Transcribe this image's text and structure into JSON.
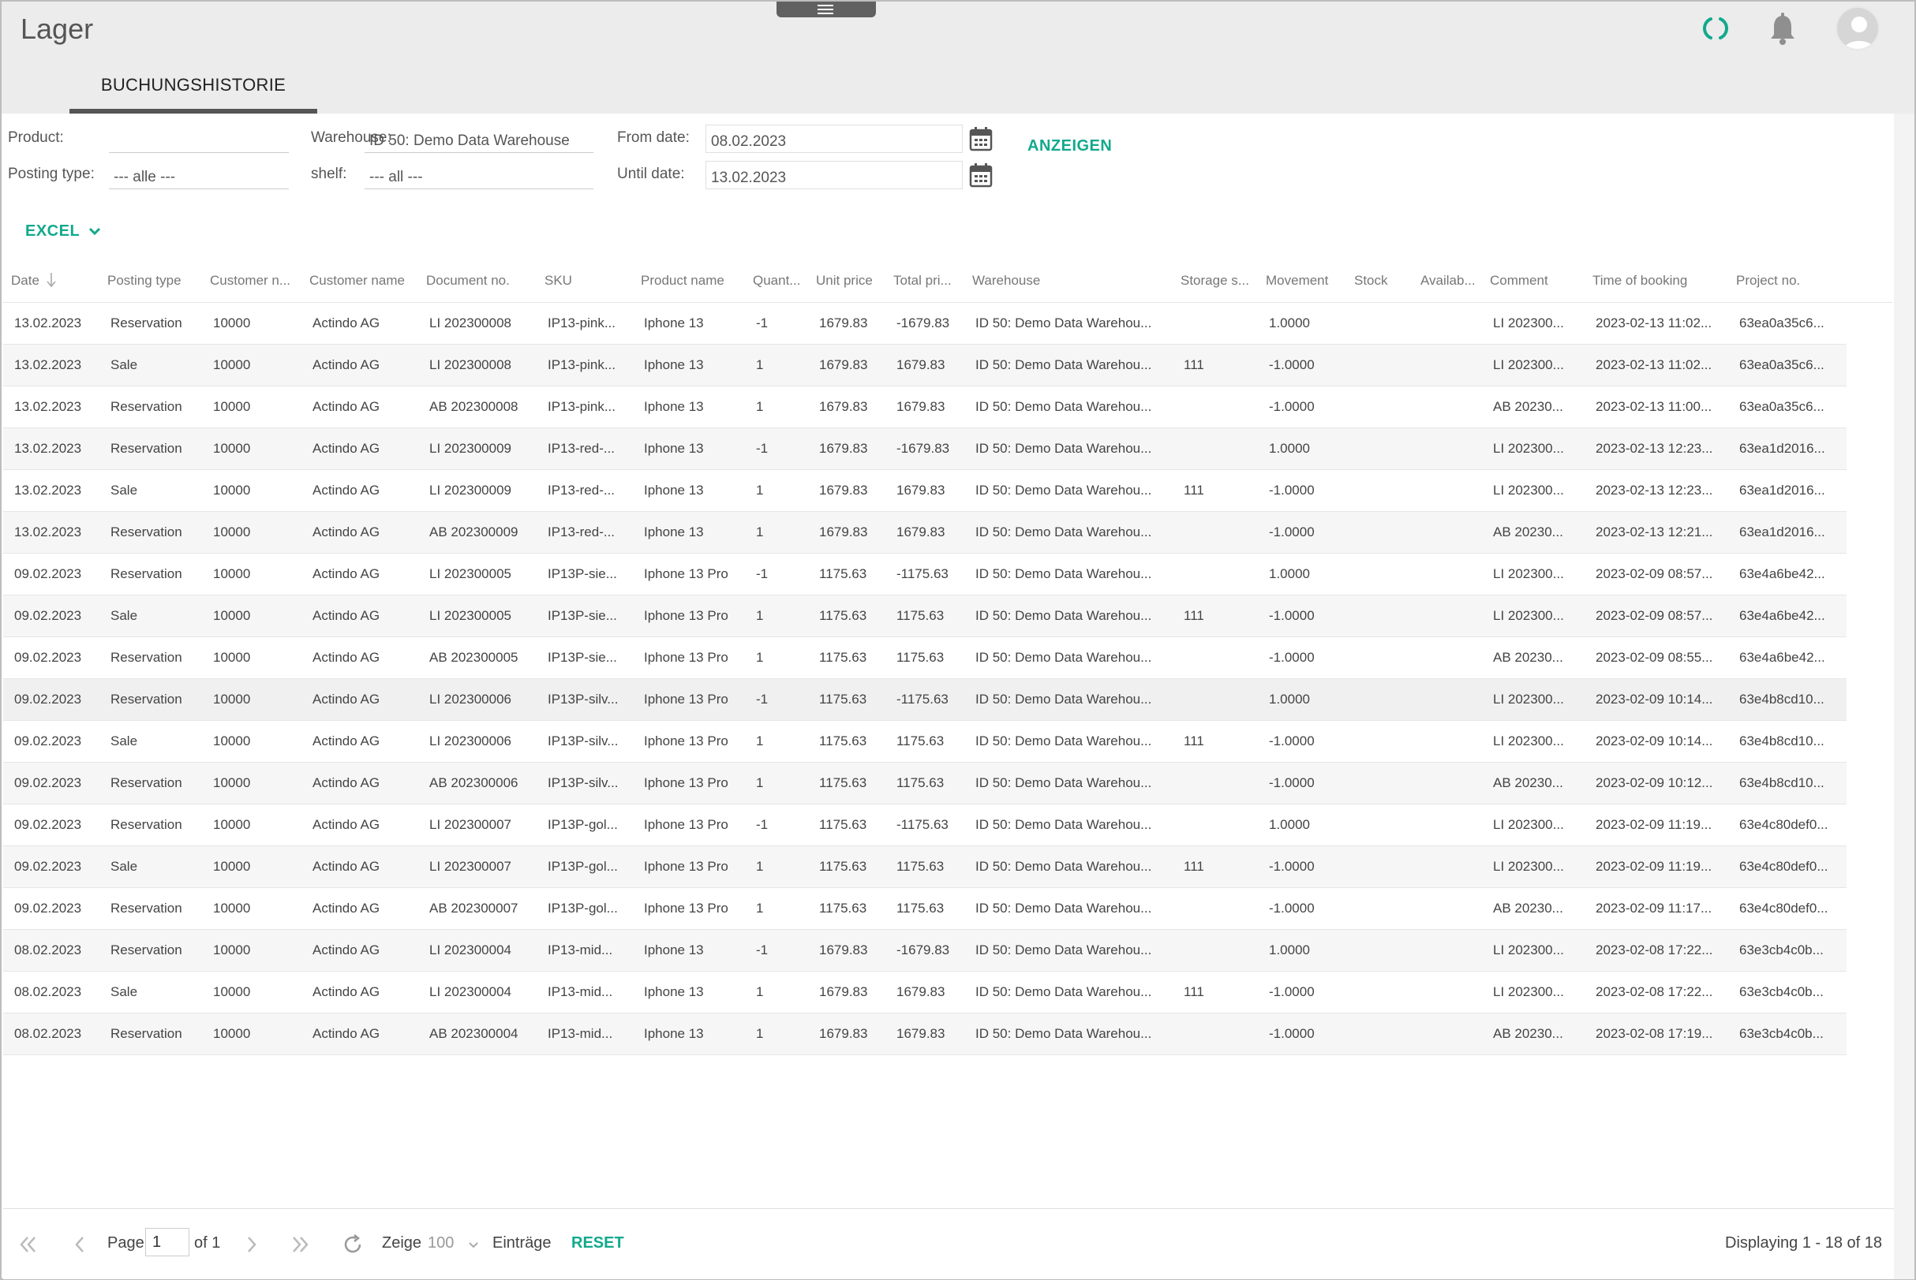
{
  "app": {
    "title": "Lager"
  },
  "tabs": [
    {
      "label": "BUCHUNGSHISTORIE"
    }
  ],
  "filters": {
    "product_label": "Product:",
    "product_value": "",
    "posting_type_label": "Posting type:",
    "posting_type_value": "--- alle ---",
    "warehouse_label": "Warehouse:",
    "warehouse_value": "ID 50: Demo Data Warehouse",
    "shelf_label": "shelf:",
    "shelf_value": "--- all ---",
    "from_label": "From date:",
    "from_value": "08.02.2023",
    "until_label": "Until date:",
    "until_value": "13.02.2023",
    "show_button": "ANZEIGEN",
    "excel_button": "EXCEL"
  },
  "table": {
    "columns": [
      "Date",
      "Posting type",
      "Customer n...",
      "Customer name",
      "Document no.",
      "SKU",
      "Product name",
      "Quant...",
      "Unit price",
      "Total pri...",
      "Warehouse",
      "Storage s...",
      "Movement",
      "Stock",
      "Availab...",
      "Comment",
      "Time of booking",
      "Project no."
    ],
    "rows": [
      [
        "13.02.2023",
        "Reservation",
        "10000",
        "Actindo AG",
        "LI 202300008",
        "IP13-pink...",
        "Iphone 13",
        "-1",
        "1679.83",
        "-1679.83",
        "ID 50: Demo Data Warehou...",
        "",
        "1.0000",
        "",
        "",
        "LI 202300...",
        "2023-02-13 11:02...",
        "63ea0a35c6..."
      ],
      [
        "13.02.2023",
        "Sale",
        "10000",
        "Actindo AG",
        "LI 202300008",
        "IP13-pink...",
        "Iphone 13",
        "1",
        "1679.83",
        "1679.83",
        "ID 50: Demo Data Warehou...",
        "111",
        "-1.0000",
        "",
        "",
        "LI 202300...",
        "2023-02-13 11:02...",
        "63ea0a35c6..."
      ],
      [
        "13.02.2023",
        "Reservation",
        "10000",
        "Actindo AG",
        "AB 202300008",
        "IP13-pink...",
        "Iphone 13",
        "1",
        "1679.83",
        "1679.83",
        "ID 50: Demo Data Warehou...",
        "",
        "-1.0000",
        "",
        "",
        "AB 20230...",
        "2023-02-13 11:00...",
        "63ea0a35c6..."
      ],
      [
        "13.02.2023",
        "Reservation",
        "10000",
        "Actindo AG",
        "LI 202300009",
        "IP13-red-...",
        "Iphone 13",
        "-1",
        "1679.83",
        "-1679.83",
        "ID 50: Demo Data Warehou...",
        "",
        "1.0000",
        "",
        "",
        "LI 202300...",
        "2023-02-13 12:23...",
        "63ea1d2016..."
      ],
      [
        "13.02.2023",
        "Sale",
        "10000",
        "Actindo AG",
        "LI 202300009",
        "IP13-red-...",
        "Iphone 13",
        "1",
        "1679.83",
        "1679.83",
        "ID 50: Demo Data Warehou...",
        "111",
        "-1.0000",
        "",
        "",
        "LI 202300...",
        "2023-02-13 12:23...",
        "63ea1d2016..."
      ],
      [
        "13.02.2023",
        "Reservation",
        "10000",
        "Actindo AG",
        "AB 202300009",
        "IP13-red-...",
        "Iphone 13",
        "1",
        "1679.83",
        "1679.83",
        "ID 50: Demo Data Warehou...",
        "",
        "-1.0000",
        "",
        "",
        "AB 20230...",
        "2023-02-13 12:21...",
        "63ea1d2016..."
      ],
      [
        "09.02.2023",
        "Reservation",
        "10000",
        "Actindo AG",
        "LI 202300005",
        "IP13P-sie...",
        "Iphone 13 Pro",
        "-1",
        "1175.63",
        "-1175.63",
        "ID 50: Demo Data Warehou...",
        "",
        "1.0000",
        "",
        "",
        "LI 202300...",
        "2023-02-09 08:57...",
        "63e4a6be42..."
      ],
      [
        "09.02.2023",
        "Sale",
        "10000",
        "Actindo AG",
        "LI 202300005",
        "IP13P-sie...",
        "Iphone 13 Pro",
        "1",
        "1175.63",
        "1175.63",
        "ID 50: Demo Data Warehou...",
        "111",
        "-1.0000",
        "",
        "",
        "LI 202300...",
        "2023-02-09 08:57...",
        "63e4a6be42..."
      ],
      [
        "09.02.2023",
        "Reservation",
        "10000",
        "Actindo AG",
        "AB 202300005",
        "IP13P-sie...",
        "Iphone 13 Pro",
        "1",
        "1175.63",
        "1175.63",
        "ID 50: Demo Data Warehou...",
        "",
        "-1.0000",
        "",
        "",
        "AB 20230...",
        "2023-02-09 08:55...",
        "63e4a6be42..."
      ],
      [
        "09.02.2023",
        "Reservation",
        "10000",
        "Actindo AG",
        "LI 202300006",
        "IP13P-silv...",
        "Iphone 13 Pro",
        "-1",
        "1175.63",
        "-1175.63",
        "ID 50: Demo Data Warehou...",
        "",
        "1.0000",
        "",
        "",
        "LI 202300...",
        "2023-02-09 10:14...",
        "63e4b8cd10..."
      ],
      [
        "09.02.2023",
        "Sale",
        "10000",
        "Actindo AG",
        "LI 202300006",
        "IP13P-silv...",
        "Iphone 13 Pro",
        "1",
        "1175.63",
        "1175.63",
        "ID 50: Demo Data Warehou...",
        "111",
        "-1.0000",
        "",
        "",
        "LI 202300...",
        "2023-02-09 10:14...",
        "63e4b8cd10..."
      ],
      [
        "09.02.2023",
        "Reservation",
        "10000",
        "Actindo AG",
        "AB 202300006",
        "IP13P-silv...",
        "Iphone 13 Pro",
        "1",
        "1175.63",
        "1175.63",
        "ID 50: Demo Data Warehou...",
        "",
        "-1.0000",
        "",
        "",
        "AB 20230...",
        "2023-02-09 10:12...",
        "63e4b8cd10..."
      ],
      [
        "09.02.2023",
        "Reservation",
        "10000",
        "Actindo AG",
        "LI 202300007",
        "IP13P-gol...",
        "Iphone 13 Pro",
        "-1",
        "1175.63",
        "-1175.63",
        "ID 50: Demo Data Warehou...",
        "",
        "1.0000",
        "",
        "",
        "LI 202300...",
        "2023-02-09 11:19...",
        "63e4c80def0..."
      ],
      [
        "09.02.2023",
        "Sale",
        "10000",
        "Actindo AG",
        "LI 202300007",
        "IP13P-gol...",
        "Iphone 13 Pro",
        "1",
        "1175.63",
        "1175.63",
        "ID 50: Demo Data Warehou...",
        "111",
        "-1.0000",
        "",
        "",
        "LI 202300...",
        "2023-02-09 11:19...",
        "63e4c80def0..."
      ],
      [
        "09.02.2023",
        "Reservation",
        "10000",
        "Actindo AG",
        "AB 202300007",
        "IP13P-gol...",
        "Iphone 13 Pro",
        "1",
        "1175.63",
        "1175.63",
        "ID 50: Demo Data Warehou...",
        "",
        "-1.0000",
        "",
        "",
        "AB 20230...",
        "2023-02-09 11:17...",
        "63e4c80def0..."
      ],
      [
        "08.02.2023",
        "Reservation",
        "10000",
        "Actindo AG",
        "LI 202300004",
        "IP13-mid...",
        "Iphone 13",
        "-1",
        "1679.83",
        "-1679.83",
        "ID 50: Demo Data Warehou...",
        "",
        "1.0000",
        "",
        "",
        "LI 202300...",
        "2023-02-08 17:22...",
        "63e3cb4c0b..."
      ],
      [
        "08.02.2023",
        "Sale",
        "10000",
        "Actindo AG",
        "LI 202300004",
        "IP13-mid...",
        "Iphone 13",
        "1",
        "1679.83",
        "1679.83",
        "ID 50: Demo Data Warehou...",
        "111",
        "-1.0000",
        "",
        "",
        "LI 202300...",
        "2023-02-08 17:22...",
        "63e3cb4c0b..."
      ],
      [
        "08.02.2023",
        "Reservation",
        "10000",
        "Actindo AG",
        "AB 202300004",
        "IP13-mid...",
        "Iphone 13",
        "1",
        "1679.83",
        "1679.83",
        "ID 50: Demo Data Warehou...",
        "",
        "-1.0000",
        "",
        "",
        "AB 20230...",
        "2023-02-08 17:19...",
        "63e3cb4c0b..."
      ]
    ]
  },
  "pager": {
    "page_label": "Page",
    "page_value": "1",
    "of_label": "of 1",
    "show_label": "Zeige",
    "page_size": "100",
    "entries_label": "Einträge",
    "reset_button": "RESET",
    "displaying": "Displaying 1 - 18 of 18"
  },
  "colors": {
    "accent": "#12a98d",
    "header_bg": "#ececec"
  },
  "icons": [
    "menu-icon",
    "spinner-icon",
    "bell-icon",
    "avatar-icon",
    "calendar-icon",
    "chevron-down-icon",
    "sort-down-icon",
    "first-page-icon",
    "prev-page-icon",
    "next-page-icon",
    "last-page-icon",
    "refresh-icon"
  ]
}
